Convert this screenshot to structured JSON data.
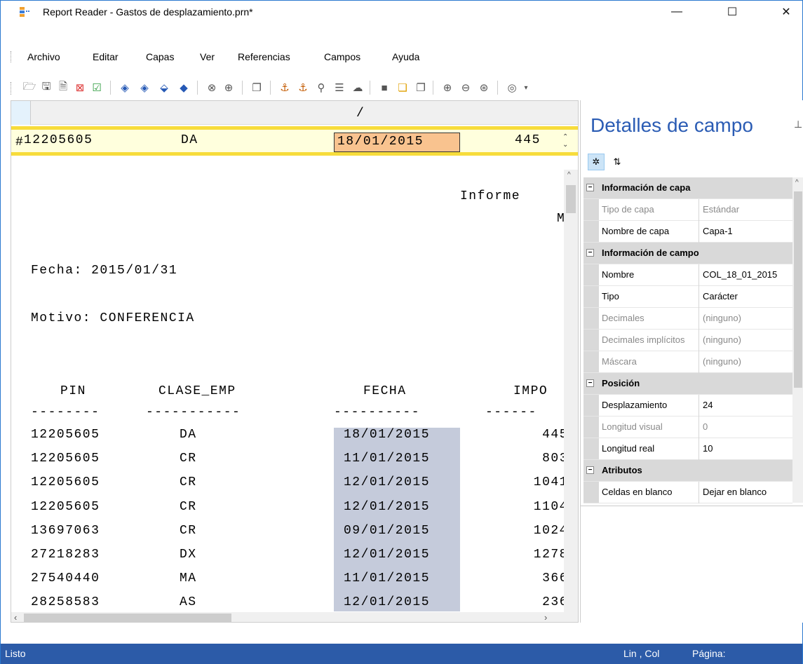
{
  "window": {
    "title": "Report Reader - Gastos de desplazamiento.prn*",
    "minimize": "—",
    "maximize": "☐",
    "close": "✕"
  },
  "menu": [
    "Archivo",
    "Editar",
    "Capas",
    "Ver",
    "Referencias",
    "Campos",
    "Ayuda"
  ],
  "toolbar_icons": [
    "open-icon",
    "save-icon",
    "export-icon",
    "delete-layer-icon",
    "accept-layer-icon",
    "nav-first-icon",
    "nav-prev-icon",
    "nav-next-icon",
    "nav-last-icon",
    "remove-field-icon",
    "find-icon",
    "copy-icon",
    "anchor-icon",
    "anchor-remove-icon",
    "wrench-icon",
    "add-field-icon",
    "cloud-icon",
    "layer-icon",
    "layer-highlight-icon",
    "layer-alt-icon",
    "zoom-in-icon",
    "zoom-out-icon",
    "zoom-fit-icon",
    "view-icon"
  ],
  "report": {
    "ruler_mark": "/",
    "sample": {
      "marker": "#",
      "pin": "12205605",
      "clase": "DA",
      "fecha": "18/01/2015",
      "importe": "445"
    },
    "header_lines": {
      "informe": "Informe",
      "m": "M",
      "fecha": "Fecha: 2015/01/31",
      "motivo": "Motivo: CONFERENCIA"
    },
    "columns": {
      "pin": "PIN",
      "clase": "CLASE_EMP",
      "fecha": "FECHA",
      "importe": "IMPO",
      "dash_pin": "--------",
      "dash_clase": "-----------",
      "dash_fecha": "----------",
      "dash_importe": "------"
    },
    "rows": [
      {
        "pin": "12205605",
        "clase": "DA",
        "fecha": "18/01/2015",
        "importe": "445"
      },
      {
        "pin": "12205605",
        "clase": "CR",
        "fecha": "11/01/2015",
        "importe": "803"
      },
      {
        "pin": "12205605",
        "clase": "CR",
        "fecha": "12/01/2015",
        "importe": "1041"
      },
      {
        "pin": "12205605",
        "clase": "CR",
        "fecha": "12/01/2015",
        "importe": "1104"
      },
      {
        "pin": "13697063",
        "clase": "CR",
        "fecha": "09/01/2015",
        "importe": "1024"
      },
      {
        "pin": "27218283",
        "clase": "DX",
        "fecha": "12/01/2015",
        "importe": "1278"
      },
      {
        "pin": "27540440",
        "clase": "MA",
        "fecha": "11/01/2015",
        "importe": "366"
      },
      {
        "pin": "28258583",
        "clase": "AS",
        "fecha": "12/01/2015",
        "importe": "236"
      }
    ]
  },
  "panel": {
    "title": "Detalles de campo",
    "pin_glyph": "⊥",
    "sections": [
      {
        "category": "Información de capa",
        "items": [
          {
            "name": "Tipo de capa",
            "value": "Estándar",
            "disabled": true
          },
          {
            "name": "Nombre de capa",
            "value": "Capa-1",
            "disabled": false
          }
        ]
      },
      {
        "category": "Información de campo",
        "items": [
          {
            "name": "Nombre",
            "value": "COL_18_01_2015",
            "disabled": false
          },
          {
            "name": "Tipo",
            "value": "Carácter",
            "disabled": false
          },
          {
            "name": "Decimales",
            "value": "(ninguno)",
            "disabled": true
          },
          {
            "name": "Decimales implícitos",
            "value": "(ninguno)",
            "disabled": true
          },
          {
            "name": "Máscara",
            "value": "(ninguno)",
            "disabled": true
          }
        ]
      },
      {
        "category": "Posición",
        "items": [
          {
            "name": "Desplazamiento",
            "value": "24",
            "disabled": false
          },
          {
            "name": "Longitud visual",
            "value": "0",
            "disabled": true
          },
          {
            "name": "Longitud real",
            "value": "10",
            "disabled": false
          }
        ]
      },
      {
        "category": "Atributos",
        "items": [
          {
            "name": "Celdas en blanco",
            "value": "Dejar en blanco",
            "disabled": false
          }
        ]
      }
    ]
  },
  "status": {
    "left": "Listo",
    "lincol": "Lin , Col",
    "page": "Página:"
  },
  "colors": {
    "accent": "#2c5ba8",
    "title_blue": "#2b5cb4",
    "sample_row_bg": "#ffffdd",
    "sample_border": "#f7dc3b",
    "selected_field": "#f9c38f",
    "field_highlight": "#c5cbdb",
    "category_bg": "#d9d9d9"
  }
}
